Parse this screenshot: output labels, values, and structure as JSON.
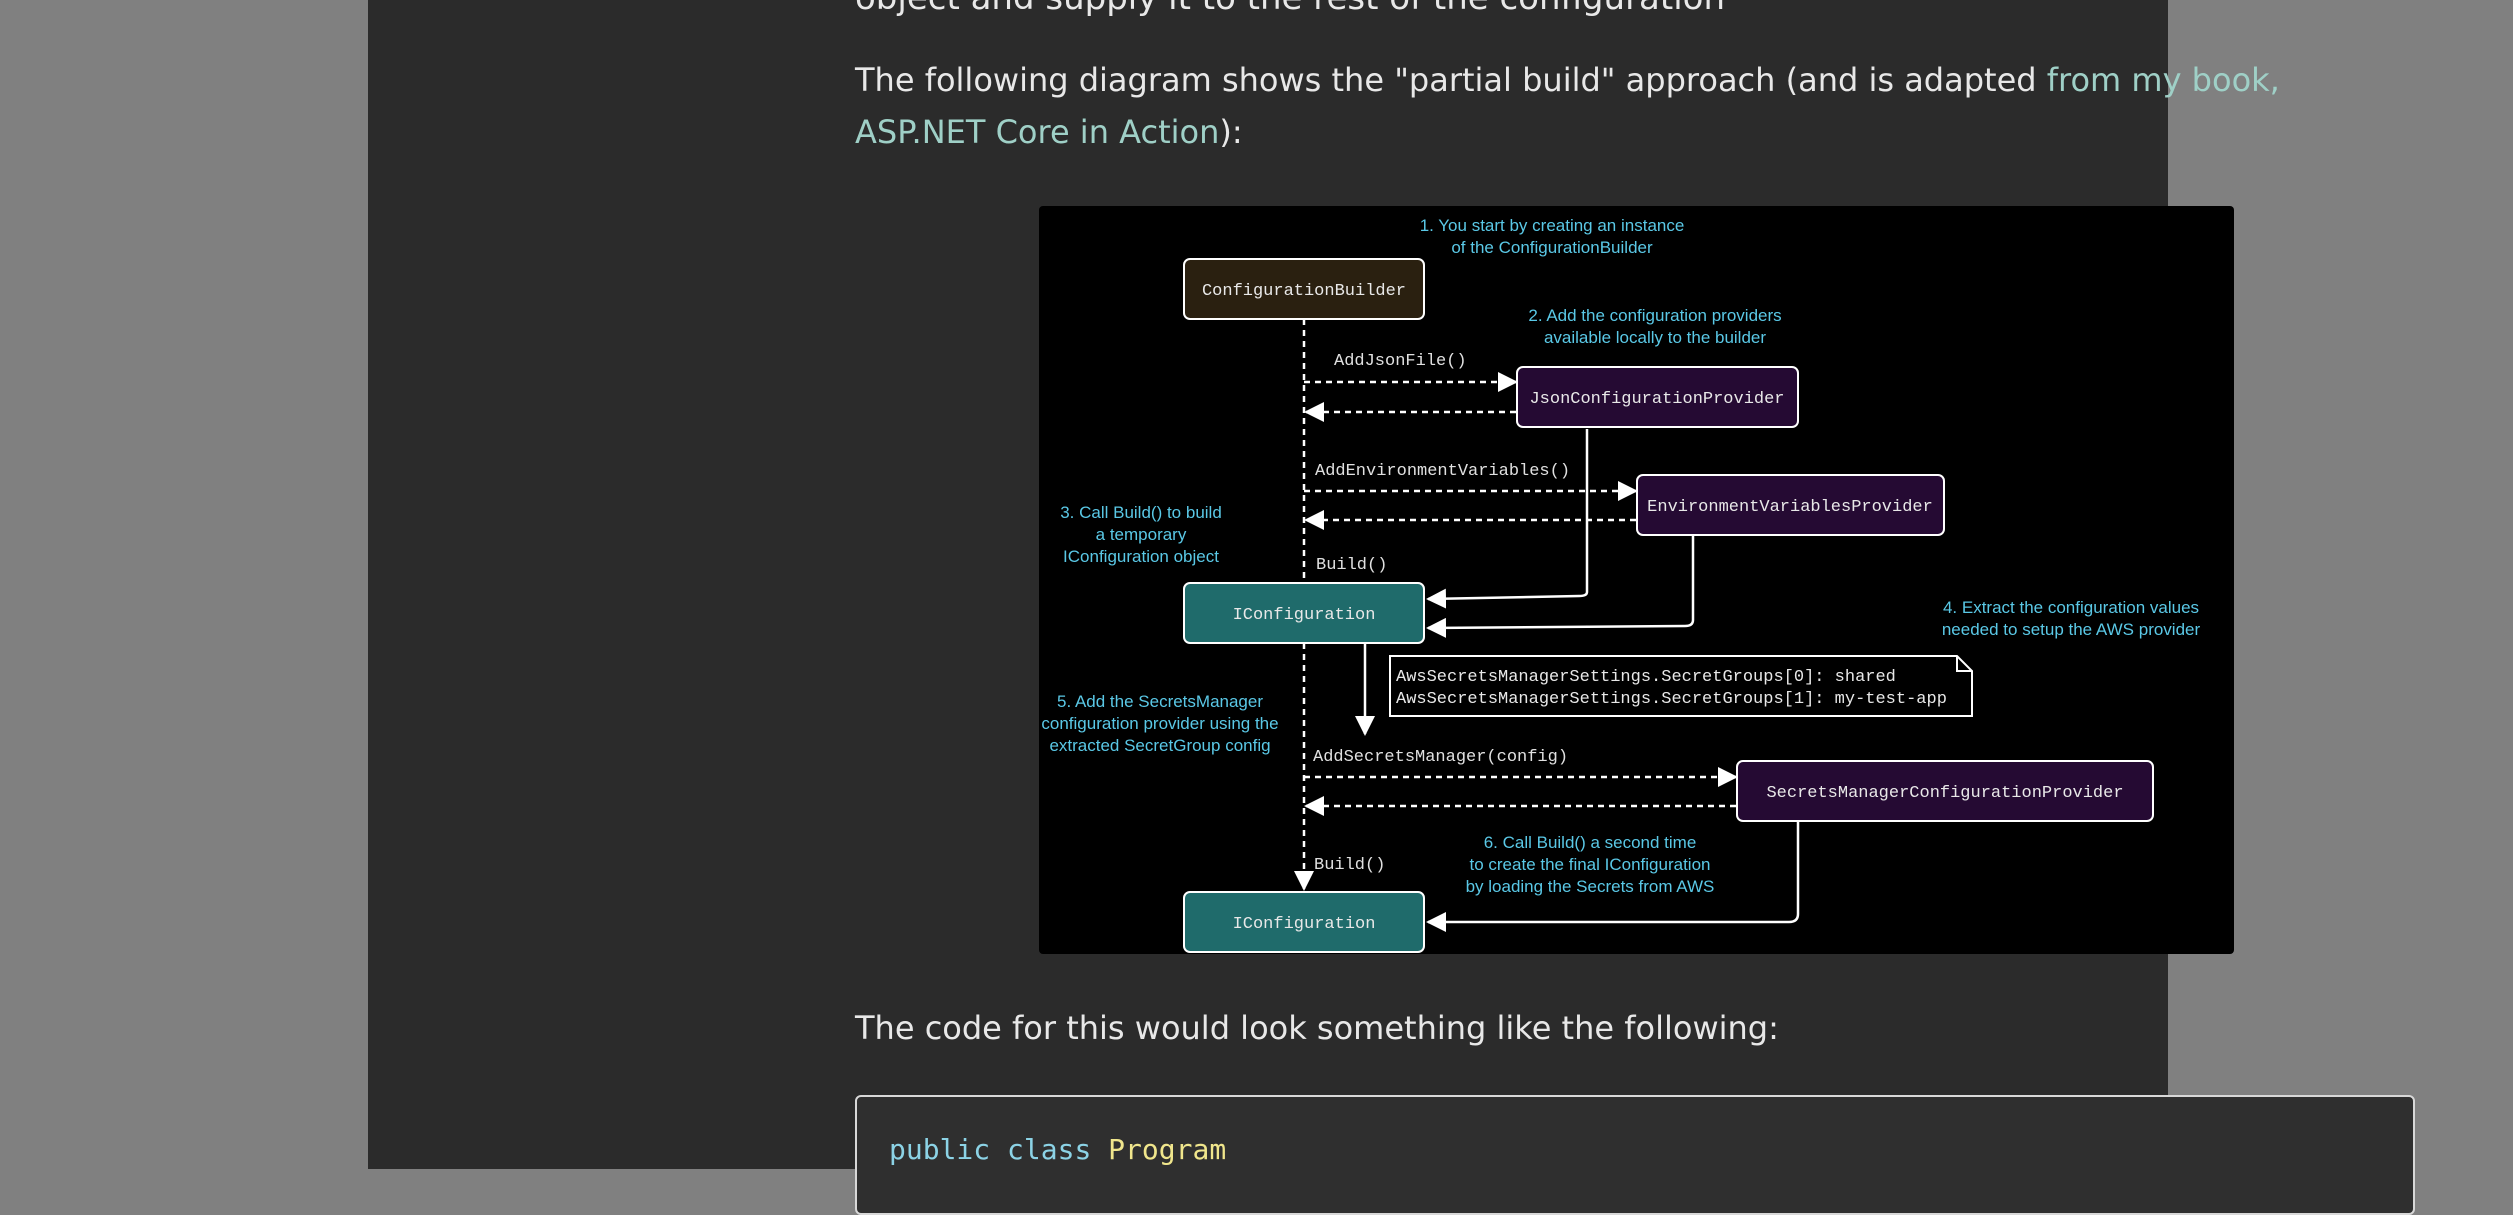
{
  "article": {
    "truncated_line": "object and supply it to the rest of the configuration",
    "intro_prefix": "The following diagram shows the \"partial build\" approach (and is adapted ",
    "intro_link": "from my book, ASP.NET Core in Action",
    "intro_suffix": "):",
    "code_intro": "The code for this would look something like the following:"
  },
  "code": {
    "kw_public": "public",
    "kw_class": "class",
    "type_name": "Program"
  },
  "diagram": {
    "boxes": {
      "config_builder": "ConfigurationBuilder",
      "json_provider": "JsonConfigurationProvider",
      "env_provider": "EnvironmentVariablesProvider",
      "iconfiguration_temp": "IConfiguration",
      "secrets_provider": "SecretsManagerConfigurationProvider",
      "iconfiguration_final": "IConfiguration"
    },
    "calls": {
      "add_json": "AddJsonFile()",
      "add_env": "AddEnvironmentVariables()",
      "build_1": "Build()",
      "add_secrets": "AddSecretsManager(config)",
      "build_2": "Build()"
    },
    "settings_note": {
      "line1": "AwsSecretsManagerSettings.SecretGroups[0]: shared",
      "line2": "AwsSecretsManagerSettings.SecretGroups[1]: my-test-app"
    },
    "notes": {
      "n1_line1": "1. You start by creating an instance",
      "n1_line2": "of the ConfigurationBuilder",
      "n2_line1": "2. Add the configuration providers",
      "n2_line2": "available locally to the builder",
      "n3_line1": "3. Call Build() to build",
      "n3_line2": "a temporary",
      "n3_line3": "IConfiguration object",
      "n4_line1": "4. Extract the configuration values",
      "n4_line2": "needed to setup the AWS provider",
      "n5_line1": "5. Add the SecretsManager",
      "n5_line2": "configuration provider using the",
      "n5_line3": "extracted SecretGroup config",
      "n6_line1": "6. Call Build() a second time",
      "n6_line2": "to create the final IConfiguration",
      "n6_line3": "by loading the Secrets from AWS"
    },
    "colors": {
      "builder_fill": "#2a2010",
      "provider_fill": "#250a33",
      "iconfig_fill": "#1f6b6b",
      "note_text": "#5ac8e6"
    }
  }
}
